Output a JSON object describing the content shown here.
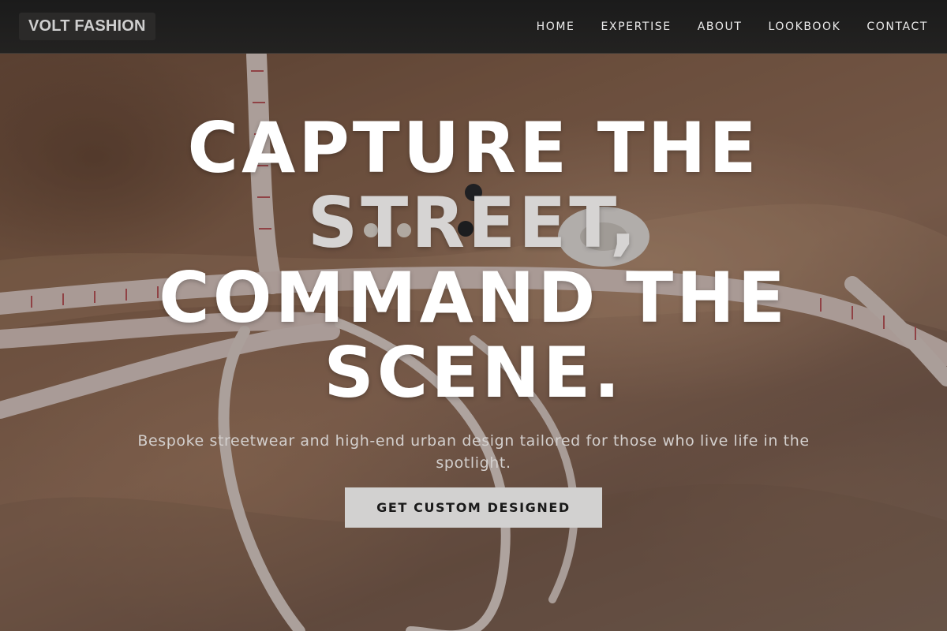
{
  "brand": {
    "name": "VOLT FASHION"
  },
  "nav": {
    "items": [
      {
        "label": "HOME"
      },
      {
        "label": "EXPERTISE"
      },
      {
        "label": "ABOUT"
      },
      {
        "label": "LOOKBOOK"
      },
      {
        "label": "CONTACT"
      }
    ]
  },
  "hero": {
    "headline_lines": [
      "CAPTURE THE",
      "STREET,",
      "COMMAND THE",
      "SCENE."
    ],
    "subtitle": "Bespoke streetwear and high-end urban design tailored for those who live life in the spotlight.",
    "cta_label": "GET CUSTOM DESIGNED",
    "background_icon": "tailoring-photo"
  },
  "colors": {
    "header_bg": "#1e1e1e",
    "cta_bg": "#d2d1d0",
    "headline": "#ffffff"
  }
}
